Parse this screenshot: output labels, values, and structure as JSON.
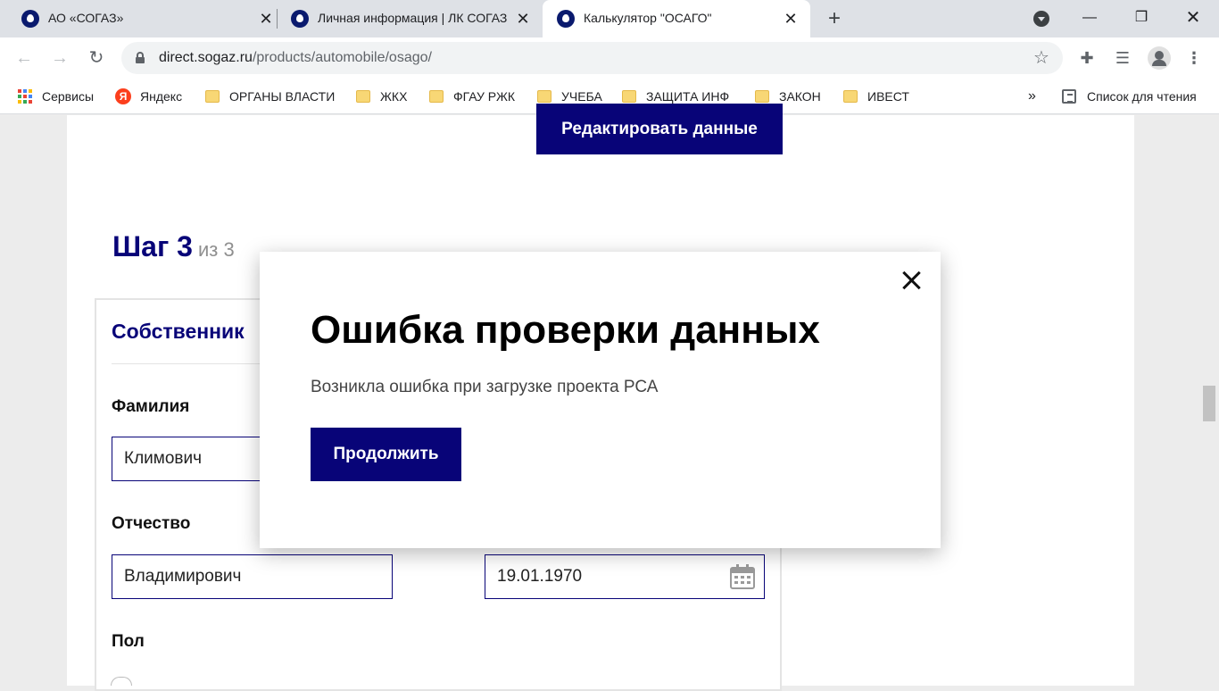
{
  "browser": {
    "tabs": [
      {
        "title": "АО «СОГАЗ»",
        "active": false
      },
      {
        "title": "Личная информация | ЛК СОГАЗ",
        "active": false
      },
      {
        "title": "Калькулятор \"ОСАГО\"",
        "active": true
      }
    ],
    "url_host": "direct.sogaz.ru",
    "url_path": "/products/automobile/osago/",
    "bookmarks": [
      "Сервисы",
      "Яндекс",
      "ОРГАНЫ ВЛАСТИ",
      "ЖКХ",
      "ФГАУ РЖК",
      "УЧЕБА",
      "ЗАЩИТА ИНФ",
      "ЗАКОН",
      "ИВЕСТ"
    ],
    "bookmarks_more": "»",
    "reading_list": "Список для чтения",
    "yandex_letter": "Я",
    "icons": {
      "back": "arrow-left-icon",
      "forward": "arrow-right-icon",
      "reload": "reload-icon",
      "lock": "lock-icon",
      "star": "star-icon",
      "extensions": "puzzle-icon",
      "media": "media-queue-icon",
      "profile": "profile-icon",
      "menu": "kebab-menu-icon"
    }
  },
  "page": {
    "edit_button": "Редактировать данные",
    "step_label": "Шаг 3",
    "step_of": "из 3",
    "section_title": "Собственник",
    "fields": {
      "surname_label": "Фамилия",
      "surname_value": "Климович",
      "patronymic_label": "Отчество",
      "patronymic_value": "Владимирович",
      "birthdate_value": "19.01.1970",
      "gender_label": "Пол"
    }
  },
  "modal": {
    "title": "Ошибка проверки данных",
    "message": "Возникла ошибка при загрузке проекта РСА",
    "continue_button": "Продолжить"
  },
  "colors": {
    "brand_navy": "#080478",
    "muted_gray": "#8f8f8f"
  }
}
